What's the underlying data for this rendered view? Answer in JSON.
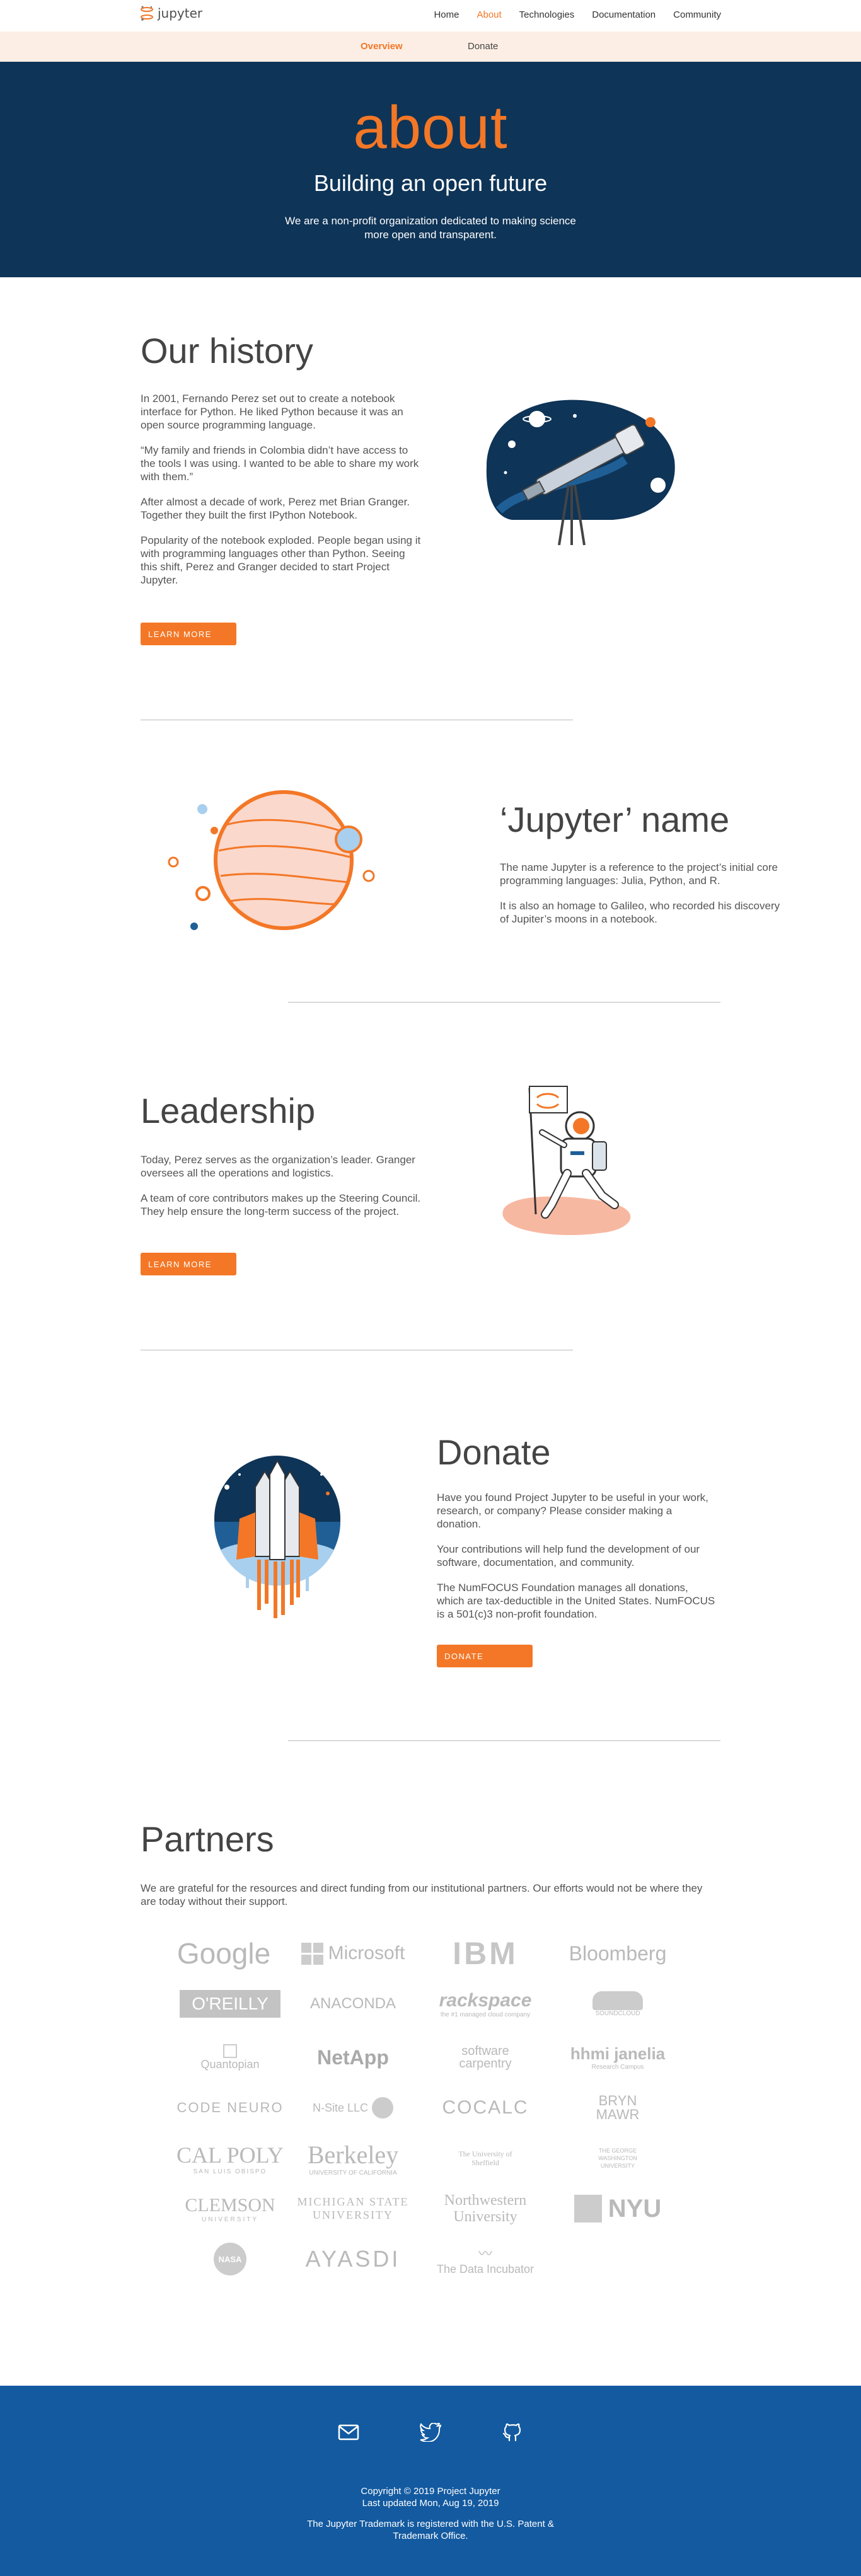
{
  "nav": {
    "logo_text": "jupyter",
    "links": [
      {
        "label": "Home"
      },
      {
        "label": "About"
      },
      {
        "label": "Technologies"
      },
      {
        "label": "Documentation"
      },
      {
        "label": "Community"
      }
    ]
  },
  "subnav": {
    "overview": "Overview",
    "donate": "Donate"
  },
  "hero": {
    "title": "about",
    "subtitle": "Building an open future",
    "text": "We are a non-profit organization dedicated to making science more open and transparent."
  },
  "history": {
    "title": "Our history",
    "paragraphs": [
      "In 2001, Fernando Perez set out to create a notebook interface for Python. He liked Python because it was an open source programming language.",
      "“My family and friends in Colombia didn’t have access to the tools I was using. I wanted to be able to share my work with them.”",
      "After almost a decade of work, Perez met Brian Granger. Together they built the first IPython Notebook.",
      "Popularity of the notebook exploded. People began using it with programming languages other than Python. Seeing this shift, Perez and Granger decided to start Project Jupyter."
    ],
    "button": "LEARN MORE"
  },
  "name_section": {
    "title": "‘Jupyter’ name",
    "paragraphs": [
      "The name Jupyter is a reference to the project’s initial core programming languages: Julia, Python, and R.",
      "It is also an homage to Galileo, who recorded his discovery of Jupiter’s moons in a notebook."
    ]
  },
  "leadership": {
    "title": "Leadership",
    "paragraphs": [
      "Today, Perez serves as the organization’s leader. Granger oversees all the operations and logistics.",
      "A team of core contributors makes up the Steering Council. They help ensure the long-term success of the project."
    ],
    "button": "LEARN MORE"
  },
  "donate": {
    "title": "Donate",
    "paragraphs": [
      "Have you found Project Jupyter to be useful in your work, research, or company? Please consider making a donation.",
      "Your contributions will help fund the development of our software, documentation, and community.",
      "The NumFOCUS Foundation manages all donations, which are tax-deductible in the United States. NumFOCUS is a 501(c)3 non-profit foundation."
    ],
    "button": "DONATE"
  },
  "partners": {
    "title": "Partners",
    "intro": "We are grateful for the resources and direct funding from our institutional partners. Our efforts would not be where they are today without their support.",
    "logos": [
      "Google",
      "Microsoft",
      "IBM",
      "Bloomberg",
      "O'REILLY",
      "ANACONDA",
      "rackspace",
      "SOUNDCLOUD",
      "Quantopian",
      "NetApp",
      "software carpentry",
      "hhmi janelia",
      "CODE NEURO",
      "N-Site LLC",
      "COCALC",
      "BRYN MAWR",
      "CAL POLY",
      "Berkeley",
      "The University of Sheffield",
      "THE GEORGE WASHINGTON UNIVERSITY",
      "CLEMSON",
      "MICHIGAN STATE UNIVERSITY",
      "Northwestern University",
      "NYU",
      "NASA",
      "AYASDI",
      "The Data Incubator"
    ],
    "logo_subs": {
      "rackspace": "the #1 managed cloud company",
      "hhmi janelia": "Research Campus",
      "CAL POLY": "SAN LUIS OBISPO",
      "Berkeley": "UNIVERSITY OF CALIFORNIA",
      "CLEMSON": "UNIVERSITY"
    }
  },
  "footer": {
    "copyright": "Copyright © 2019 Project Jupyter",
    "updated": "Last updated Mon, Aug 19, 2019",
    "trademark": "The Jupyter Trademark is registered with the U.S. Patent & Trademark Office.",
    "icons": [
      "mail-icon",
      "twitter-icon",
      "github-icon"
    ]
  },
  "colors": {
    "accent": "#F37726",
    "navy": "#0e3457",
    "footer": "#135aa0",
    "subnav": "#fdeee5"
  }
}
